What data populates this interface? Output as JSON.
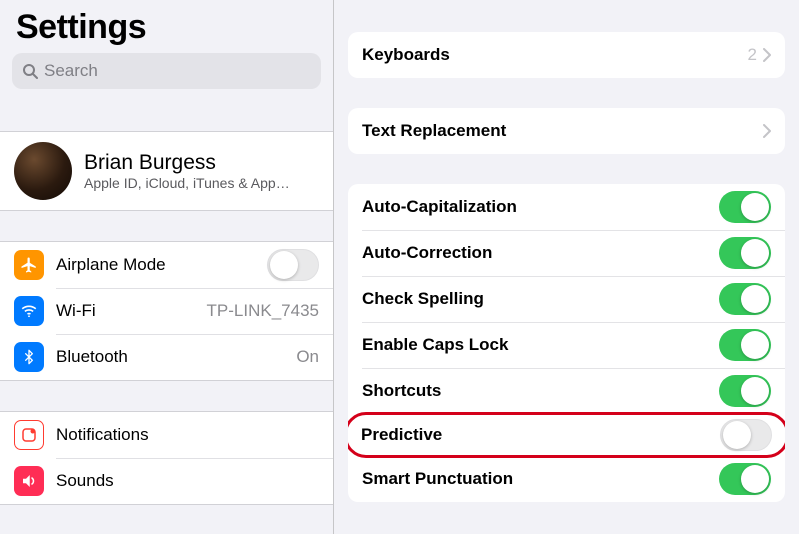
{
  "sidebar": {
    "title": "Settings",
    "searchPlaceholder": "Search",
    "profile": {
      "name": "Brian Burgess",
      "subtitle": "Apple ID, iCloud, iTunes & App…"
    },
    "network": {
      "airplane": {
        "label": "Airplane Mode",
        "on": false
      },
      "wifi": {
        "label": "Wi-Fi",
        "value": "TP-LINK_7435"
      },
      "bluetooth": {
        "label": "Bluetooth",
        "value": "On"
      }
    },
    "more": {
      "notifications": {
        "label": "Notifications"
      },
      "sounds": {
        "label": "Sounds"
      }
    }
  },
  "detail": {
    "keyboards": {
      "label": "Keyboards",
      "count": "2"
    },
    "textReplacement": {
      "label": "Text Replacement"
    },
    "toggles": {
      "autoCap": {
        "label": "Auto-Capitalization",
        "on": true
      },
      "autoCorr": {
        "label": "Auto-Correction",
        "on": true
      },
      "spell": {
        "label": "Check Spelling",
        "on": true
      },
      "capsLock": {
        "label": "Enable Caps Lock",
        "on": true
      },
      "shortcuts": {
        "label": "Shortcuts",
        "on": true
      },
      "predictive": {
        "label": "Predictive",
        "on": false
      },
      "smartPunct": {
        "label": "Smart Punctuation",
        "on": true
      }
    }
  }
}
